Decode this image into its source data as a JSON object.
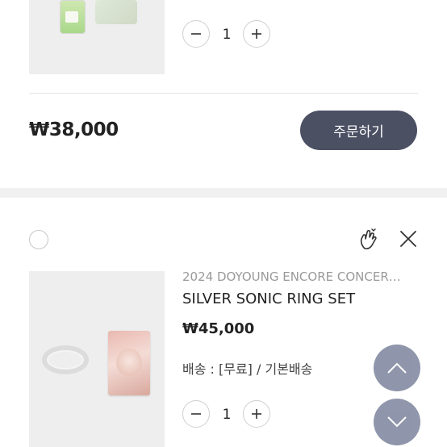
{
  "prev_item": {
    "quantity": "1",
    "total_price": "₩38,000",
    "order_button": "주문하기"
  },
  "item": {
    "series": "2024 DOYOUNG ENCORE CONCER…",
    "name": "SILVER SONIC RING SET",
    "price": "₩45,000",
    "shipping": "배송 : [무료] / 기본배송",
    "quantity": "1"
  },
  "icons": {
    "minus": "minus-icon",
    "plus": "plus-icon",
    "wishlist": "finger-heart-icon",
    "close": "close-icon",
    "scroll_up": "chevron-up-icon",
    "scroll_down": "chevron-down-icon"
  },
  "colors": {
    "order_button": "#4b5063",
    "scroll_button": "#8a90a6"
  }
}
